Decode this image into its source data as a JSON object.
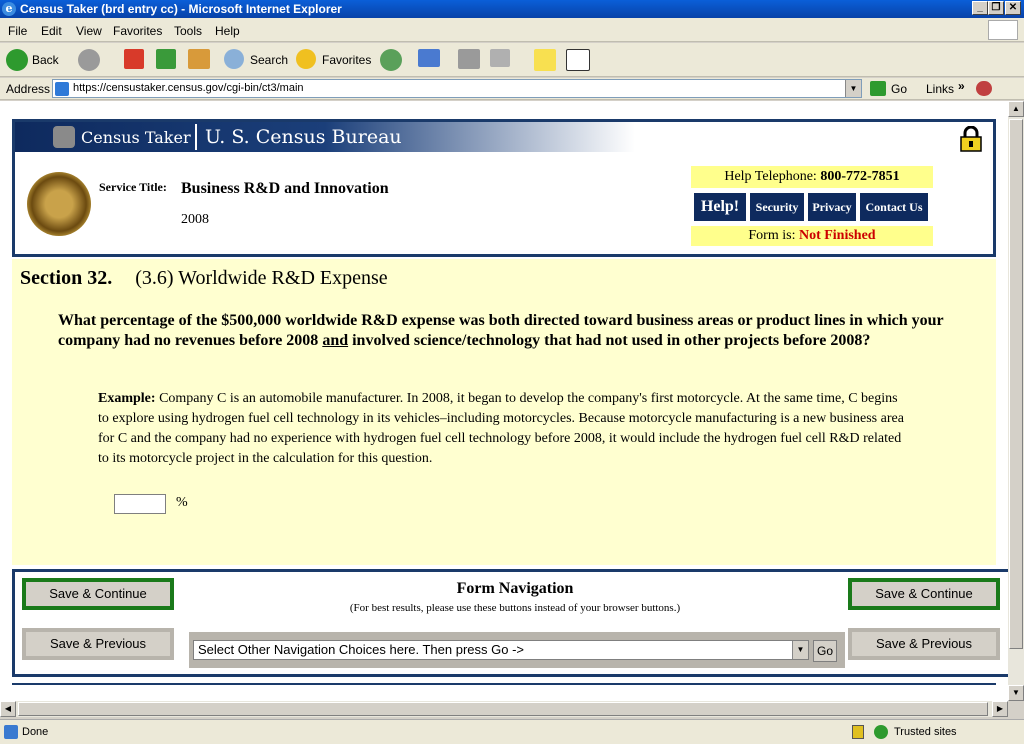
{
  "window": {
    "title": "Census Taker (brd entry cc) - Microsoft Internet Explorer"
  },
  "menu": [
    "File",
    "Edit",
    "View",
    "Favorites",
    "Tools",
    "Help"
  ],
  "toolbar": {
    "back": "Back",
    "search": "Search",
    "favorites": "Favorites"
  },
  "address": {
    "label": "Address",
    "url": "https://censustaker.census.gov/cgi-bin/ct3/main",
    "go": "Go",
    "links": "Links"
  },
  "header": {
    "app_name": "Census Taker",
    "bureau": "U. S. Census Bureau",
    "service_title_label": "Service Title:",
    "service_title": "Business R&D and Innovation",
    "year": "2008",
    "help_phone_label": "Help Telephone:",
    "help_phone": "800-772-7851",
    "nav": [
      "Help!",
      "Security",
      "Privacy",
      "Contact Us"
    ],
    "form_status_label": "Form is:",
    "form_status": "Not Finished",
    "status_color": "#cc0000"
  },
  "section": {
    "number": "Section 32.",
    "title": "(3.6) Worldwide R&D Expense",
    "q1": "What percentage of the $500,000 worldwide R&D expense was both directed toward business areas or product lines in which your company had no revenues before 2008 ",
    "q_and": "and",
    "q2": " involved science/technology that had not used in other projects before 2008?",
    "example_label": "Example:",
    "example_text": " Company C is an automobile manufacturer. In 2008, it began to develop the company's first motorcycle. At the same time, C begins to explore using hydrogen fuel cell technology in its vehicles–including motorcycles. Because motorcycle manufacturing is a new business area for C and the company had no experience with hydrogen fuel cell technology before 2008, it would include the hydrogen fuel cell R&D related to its motorcycle project in the calculation for this question.",
    "percent_value": "",
    "percent_sign": "%"
  },
  "form_nav": {
    "title": "Form Navigation",
    "subtitle": "(For best results, please use these buttons instead of your browser buttons.)",
    "save_continue": "Save & Continue",
    "save_previous": "Save & Previous",
    "select_text": "Select Other Navigation Choices here. Then press Go ->",
    "go": "Go"
  },
  "status": {
    "text": "Done",
    "zone": "Trusted sites"
  }
}
